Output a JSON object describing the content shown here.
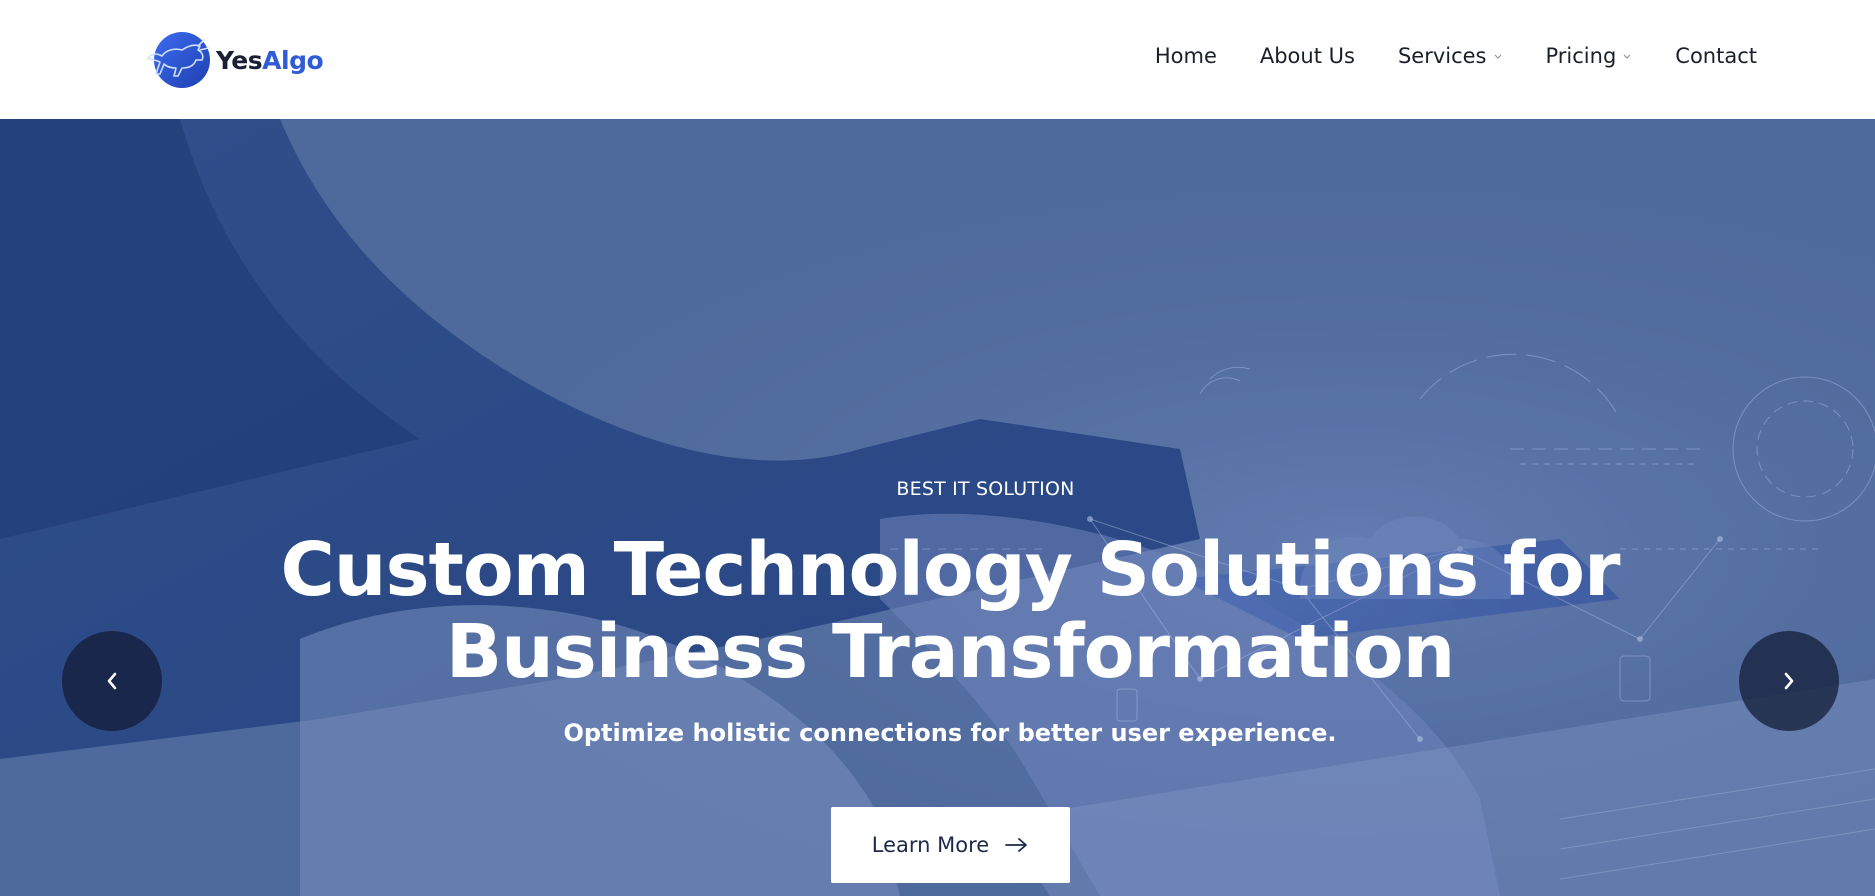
{
  "brand": {
    "name_part1": "Yes",
    "name_part2": "Algo",
    "logo_icon": "bull-icon",
    "colors": {
      "dark": "#1a1f36",
      "accent": "#2f5bd7"
    }
  },
  "nav": {
    "items": [
      {
        "label": "Home",
        "has_dropdown": false
      },
      {
        "label": "About Us",
        "has_dropdown": false
      },
      {
        "label": "Services",
        "has_dropdown": true
      },
      {
        "label": "Pricing",
        "has_dropdown": true
      },
      {
        "label": "Contact",
        "has_dropdown": false
      }
    ]
  },
  "hero": {
    "eyebrow": "BEST IT SOLUTION",
    "title_line1": "Custom Technology Solutions for",
    "title_line2": "Business Transformation",
    "subtitle": "Optimize holistic connections for better user experience.",
    "cta_label": "Learn More",
    "cta_icon": "arrow-right-icon",
    "prev_icon": "chevron-left-icon",
    "next_icon": "chevron-right-icon",
    "overlay_color": "#2f4f8f"
  }
}
